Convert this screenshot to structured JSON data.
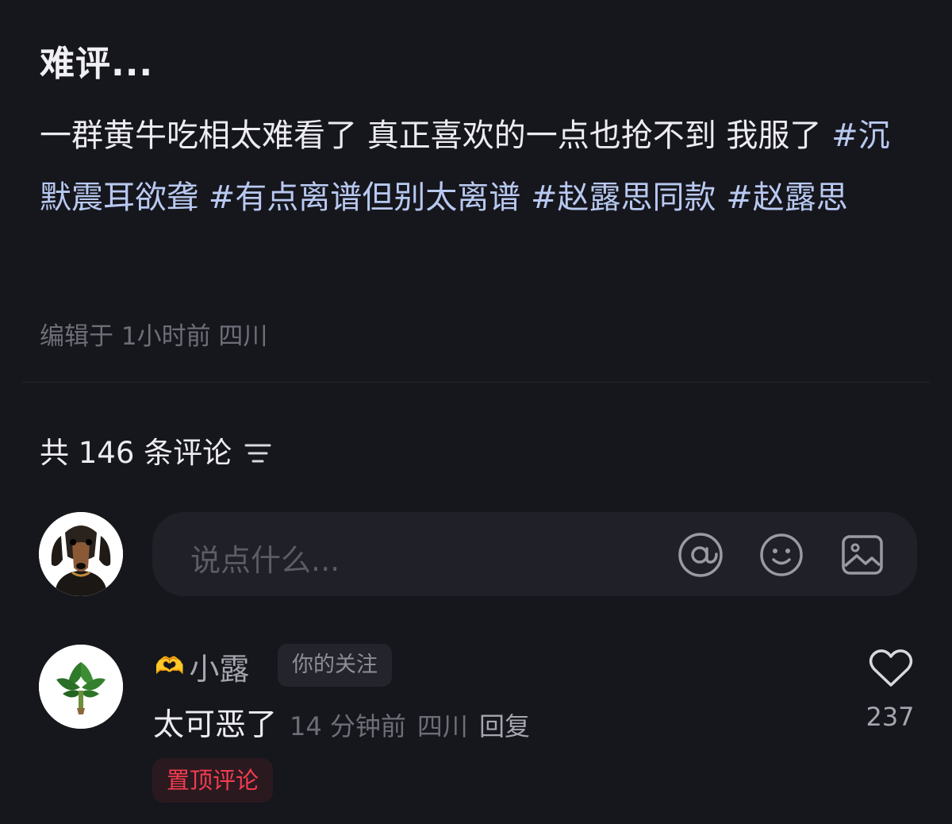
{
  "post": {
    "title": "难评...",
    "body_text": "一群黄牛吃相太难看了 真正喜欢的一点也抢不到 我服了",
    "hashtags": [
      "#沉默震耳欲聋",
      "#有点离谱但别太离谱",
      "#赵露思同款",
      "#赵露思"
    ],
    "meta": "编辑于 1小时前 四川"
  },
  "comments_header": {
    "count_label": "共 146 条评论",
    "sort_icon": "sort-icon"
  },
  "composer": {
    "placeholder": "说点什么...",
    "icons": [
      "at-icon",
      "emoji-icon",
      "image-icon"
    ]
  },
  "comments": [
    {
      "username": "小露",
      "user_emoji": "🫶",
      "badge": "你的关注",
      "text": "太可恶了",
      "time": "14 分钟前",
      "location": "四川",
      "reply_label": "回复",
      "likes": "237",
      "pinned_label": "置顶评论"
    }
  ],
  "colors": {
    "background": "#16161d",
    "hashtag": "#b8c9f0",
    "pinned": "#f23c4f"
  }
}
